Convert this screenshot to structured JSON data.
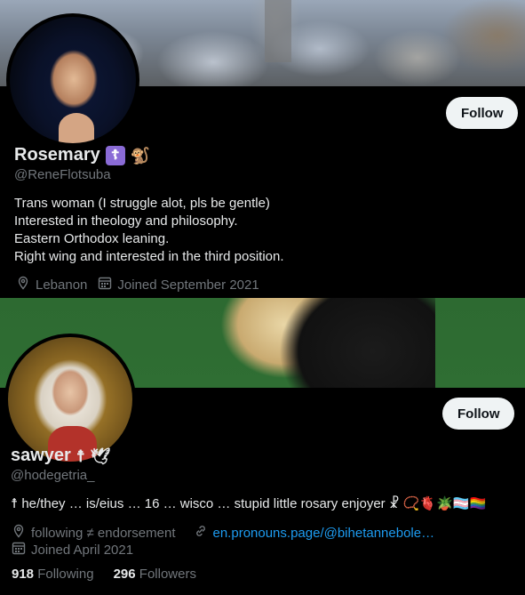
{
  "profile1": {
    "display_name": "Rosemary",
    "name_badges": [
      "☦",
      "🐒"
    ],
    "handle": "@ReneFlotsuba",
    "follow_label": "Follow",
    "bio_lines": [
      "Trans woman (I struggle alot, pls be gentle)",
      "Interested in theology and philosophy.",
      "Eastern Orthodox leaning.",
      "Right wing and interested in the third position."
    ],
    "location": "Lebanon",
    "joined": "Joined September 2021"
  },
  "profile2": {
    "display_name": "sawyer",
    "name_badges": [
      "☨",
      "🕊"
    ],
    "handle": "@hodegetria_",
    "follow_label": "Follow",
    "bio": "☨ he/they … is/eius … 16 … wisco … stupid little rosary enjoyer ☧ 📿🫀🪴🏳️‍⚧️🏳️‍🌈",
    "location": "following ≠ endorsement",
    "website": "en.pronouns.page/@bihetannebole…",
    "joined": "Joined April 2021",
    "following_count": "918",
    "following_label": "Following",
    "followers_count": "296",
    "followers_label": "Followers"
  },
  "icons": {
    "location": "location-pin-icon",
    "calendar": "calendar-icon",
    "link": "link-icon"
  },
  "colors": {
    "background": "#000000",
    "text": "#e7e9ea",
    "muted": "#71767b",
    "link": "#1d9bf0",
    "button": "#eff3f4"
  }
}
